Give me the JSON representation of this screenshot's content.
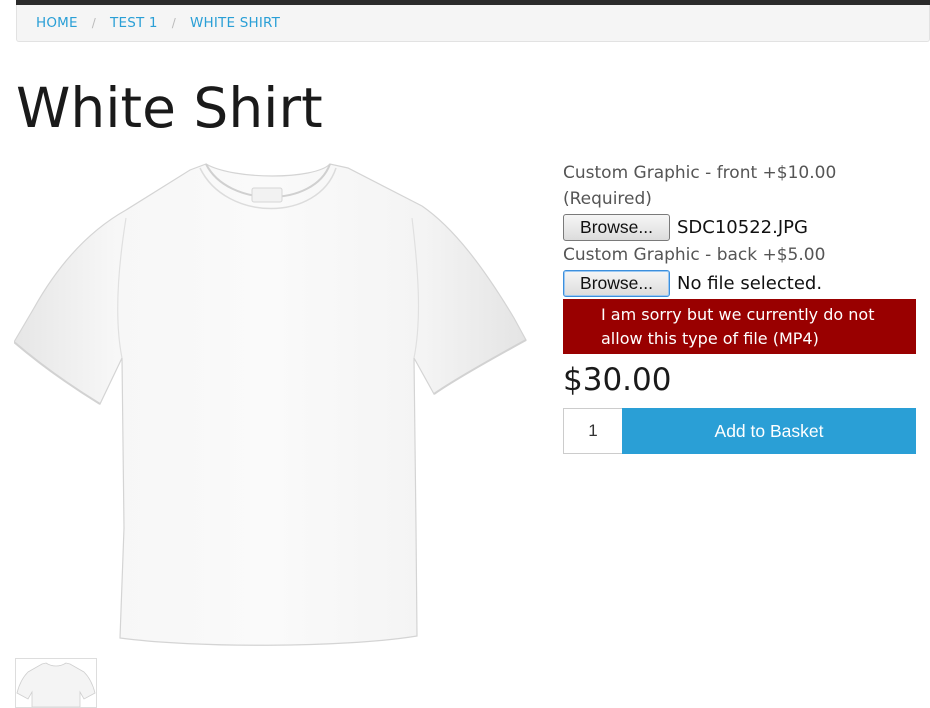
{
  "breadcrumb": {
    "items": [
      "HOME",
      "TEST 1",
      "WHITE SHIRT"
    ],
    "separator": "/"
  },
  "product": {
    "title": "White Shirt",
    "image": "white-t-shirt",
    "price": "$30.00"
  },
  "options": {
    "front": {
      "label": "Custom Graphic - front +$10.00",
      "required": "(Required)",
      "button_label": "Browse...",
      "file_name": "SDC10522.JPG"
    },
    "back": {
      "label": "Custom Graphic - back +$5.00",
      "button_label": "Browse...",
      "file_name": "No file selected."
    },
    "error": "I am sorry but we currently do not allow this type of file (MP4)"
  },
  "cart": {
    "quantity": "1",
    "add_label": "Add to Basket"
  },
  "colors": {
    "accent": "#2a9fd6",
    "error_bg": "#990000",
    "topbar": "#2b2b2b"
  }
}
